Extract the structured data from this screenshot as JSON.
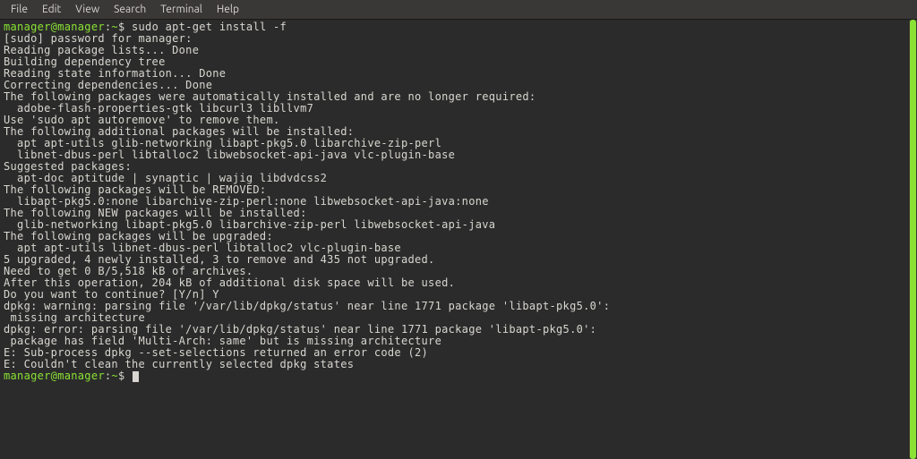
{
  "menubar": {
    "items": [
      "File",
      "Edit",
      "View",
      "Search",
      "Terminal",
      "Help"
    ]
  },
  "terminal": {
    "prompt1_user": "manager@manager",
    "prompt1_sep": ":",
    "prompt1_path": "~",
    "prompt1_symbol": "$",
    "command1": "sudo apt-get install -f",
    "lines": [
      "[sudo] password for manager:",
      "Reading package lists... Done",
      "Building dependency tree",
      "Reading state information... Done",
      "Correcting dependencies... Done",
      "The following packages were automatically installed and are no longer required:",
      "  adobe-flash-properties-gtk libcurl3 libllvm7",
      "Use 'sudo apt autoremove' to remove them.",
      "The following additional packages will be installed:",
      "  apt apt-utils glib-networking libapt-pkg5.0 libarchive-zip-perl",
      "  libnet-dbus-perl libtalloc2 libwebsocket-api-java vlc-plugin-base",
      "Suggested packages:",
      "  apt-doc aptitude | synaptic | wajig libdvdcss2",
      "The following packages will be REMOVED:",
      "  libapt-pkg5.0:none libarchive-zip-perl:none libwebsocket-api-java:none",
      "The following NEW packages will be installed:",
      "  glib-networking libapt-pkg5.0 libarchive-zip-perl libwebsocket-api-java",
      "The following packages will be upgraded:",
      "  apt apt-utils libnet-dbus-perl libtalloc2 vlc-plugin-base",
      "5 upgraded, 4 newly installed, 3 to remove and 435 not upgraded.",
      "Need to get 0 B/5,518 kB of archives.",
      "After this operation, 204 kB of additional disk space will be used.",
      "Do you want to continue? [Y/n] Y",
      "dpkg: warning: parsing file '/var/lib/dpkg/status' near line 1771 package 'libapt-pkg5.0':",
      " missing architecture",
      "dpkg: error: parsing file '/var/lib/dpkg/status' near line 1771 package 'libapt-pkg5.0':",
      " package has field 'Multi-Arch: same' but is missing architecture",
      "E: Sub-process dpkg --set-selections returned an error code (2)",
      "E: Couldn't clean the currently selected dpkg states"
    ],
    "prompt2_user": "manager@manager",
    "prompt2_sep": ":",
    "prompt2_path": "~",
    "prompt2_symbol": "$"
  }
}
